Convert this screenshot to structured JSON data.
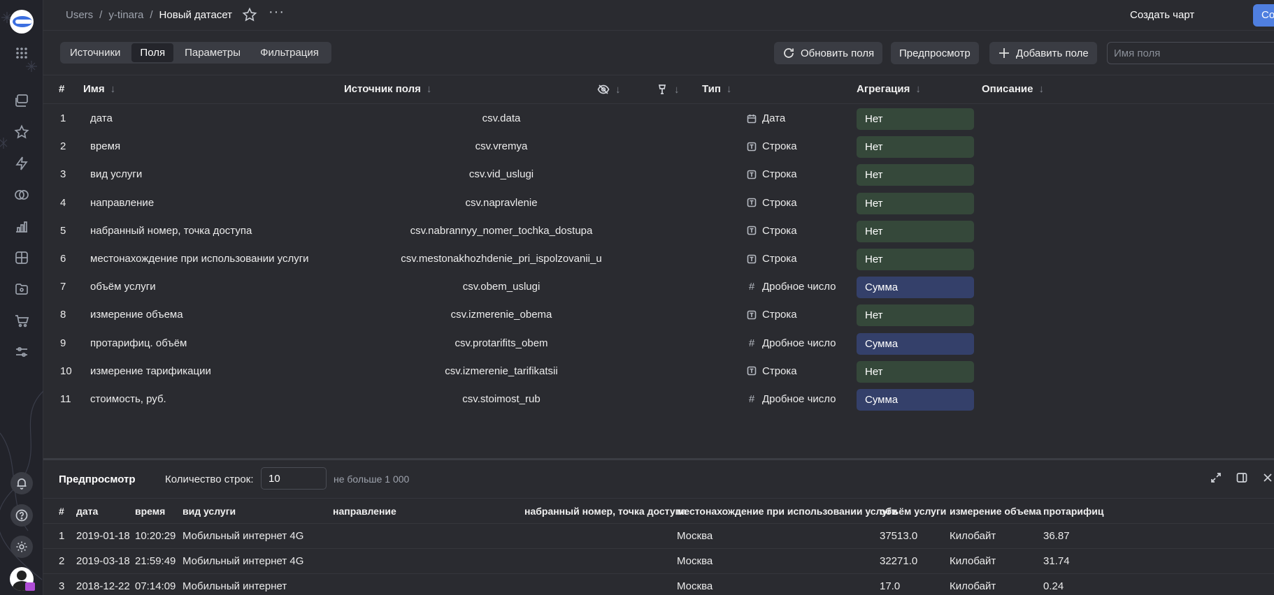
{
  "header": {
    "breadcrumbs": [
      "Users",
      "y-tinara",
      "Новый датасет"
    ],
    "create_chart": "Создать чарт",
    "save": "Сохранить"
  },
  "toolbar": {
    "tabs": [
      "Источники",
      "Поля",
      "Параметры",
      "Фильтрация"
    ],
    "active_tab": "Поля",
    "refresh_fields": "Обновить поля",
    "preview": "Предпросмотр",
    "add_field": "Добавить поле",
    "field_search_placeholder": "Имя поля"
  },
  "fields_table": {
    "columns": {
      "num": "#",
      "name": "Имя",
      "source": "Источник поля",
      "type": "Тип",
      "aggregation": "Агрегация",
      "description": "Описание"
    },
    "rows": [
      {
        "num": "1",
        "name": "дата",
        "source": "csv.data",
        "type": "Дата",
        "type_icon": "calendar-icon",
        "agg": "Нет"
      },
      {
        "num": "2",
        "name": "время",
        "source": "csv.vremya",
        "type": "Строка",
        "type_icon": "string-icon",
        "agg": "Нет"
      },
      {
        "num": "3",
        "name": "вид услуги",
        "source": "csv.vid_uslugi",
        "type": "Строка",
        "type_icon": "string-icon",
        "agg": "Нет"
      },
      {
        "num": "4",
        "name": "направление",
        "source": "csv.napravlenie",
        "type": "Строка",
        "type_icon": "string-icon",
        "agg": "Нет"
      },
      {
        "num": "5",
        "name": "набранный номер, точка доступа",
        "source": "csv.nabrannyy_nomer_tochka_dostupa",
        "type": "Строка",
        "type_icon": "string-icon",
        "agg": "Нет"
      },
      {
        "num": "6",
        "name": "местонахождение при использовании услуги",
        "source": "csv.mestonakhozhdenie_pri_ispolzovanii_u",
        "type": "Строка",
        "type_icon": "string-icon",
        "agg": "Нет"
      },
      {
        "num": "7",
        "name": "объём услуги",
        "source": "csv.obem_uslugi",
        "type": "Дробное число",
        "type_icon": "hash-icon",
        "agg": "Сумма"
      },
      {
        "num": "8",
        "name": "измерение объема",
        "source": "csv.izmerenie_obema",
        "type": "Строка",
        "type_icon": "string-icon",
        "agg": "Нет"
      },
      {
        "num": "9",
        "name": "протарифиц. объём",
        "source": "csv.protarifits_obem",
        "type": "Дробное число",
        "type_icon": "hash-icon",
        "agg": "Сумма"
      },
      {
        "num": "10",
        "name": "измерение тарификации",
        "source": "csv.izmerenie_tarifikatsii",
        "type": "Строка",
        "type_icon": "string-icon",
        "agg": "Нет"
      },
      {
        "num": "11",
        "name": "стоимость, руб.",
        "source": "csv.stoimost_rub",
        "type": "Дробное число",
        "type_icon": "hash-icon",
        "agg": "Сумма"
      }
    ]
  },
  "preview": {
    "title": "Предпросмотр",
    "row_count_label": "Количество строк:",
    "row_count_value": "10",
    "row_count_hint": "не больше 1 000",
    "columns": [
      "#",
      "дата",
      "время",
      "вид услуги",
      "направление",
      "набранный номер, точка доступа",
      "местонахождение при использовании услуги",
      "объём услуги",
      "измерение объема",
      "протарифиц"
    ],
    "rows": [
      [
        "1",
        "2019-01-18",
        "10:20:29",
        "Мобильный интернет 4G",
        "",
        "",
        "Москва",
        "37513.0",
        "Килобайт",
        "36.87"
      ],
      [
        "2",
        "2019-03-18",
        "21:59:49",
        "Мобильный интернет 4G",
        "",
        "",
        "Москва",
        "32271.0",
        "Килобайт",
        "31.74"
      ],
      [
        "3",
        "2018-12-22",
        "07:14:09",
        "Мобильный интернет",
        "",
        "",
        "Москва",
        "17.0",
        "Килобайт",
        "0.24"
      ]
    ]
  },
  "colors": {
    "accent": "#4f7fe0",
    "agg_none_bg": "#35483a",
    "agg_sum_bg": "#34406a",
    "background": "#2a2b30"
  }
}
